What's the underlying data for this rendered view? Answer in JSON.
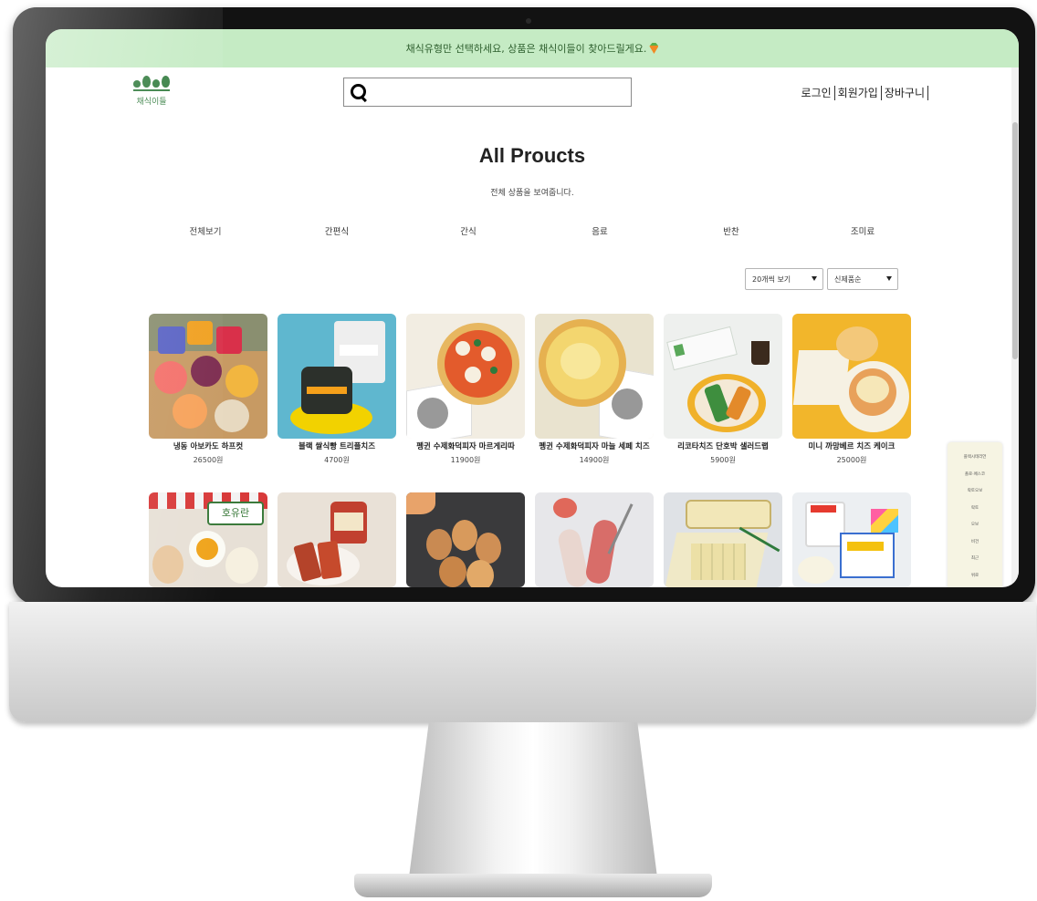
{
  "promo_banner": {
    "text": "채식유형만 선택하세요, 상품은 채식이들이 찾아드릴게요."
  },
  "logo": {
    "text": "채식이들"
  },
  "search": {
    "value": "",
    "placeholder": ""
  },
  "top_links": {
    "login": "로그인",
    "signup": "회원가입",
    "cart": "장바구니"
  },
  "page": {
    "title": "All Proucts",
    "subtitle": "전체 상품을 보여줍니다."
  },
  "categories": [
    "전체보기",
    "간편식",
    "간식",
    "음료",
    "반찬",
    "조미료"
  ],
  "filters": {
    "per_page": "20개씩 보기",
    "sort": "신제품순"
  },
  "products": [
    {
      "name": "냉동 아보카도 하프컷",
      "price": "26500원"
    },
    {
      "name": "블랙 쌀식빵 트리플치즈",
      "price": "4700원"
    },
    {
      "name": "펭귄 수제화덕피자 마르게리따",
      "price": "11900원"
    },
    {
      "name": "펭귄 수제화덕피자 마늘 세페 치즈",
      "price": "14900원"
    },
    {
      "name": "리코타치즈 단호박 샐러드랩",
      "price": "5900원"
    },
    {
      "name": "미니 까망베르 치즈 케이크",
      "price": "25000원"
    }
  ],
  "products_row2": [
    {
      "badge": "호유란"
    },
    {},
    {},
    {},
    {},
    {}
  ],
  "quick_menu": [
    "플렉시테리언",
    "폴로·페스코",
    "락토오보",
    "락토",
    "오보",
    "비건",
    "최근",
    "위로"
  ],
  "colors": {
    "banner_bg": "#c5ebc4",
    "brand_green": "#2f7a3c",
    "quick_menu_bg": "#f6f4e3"
  }
}
